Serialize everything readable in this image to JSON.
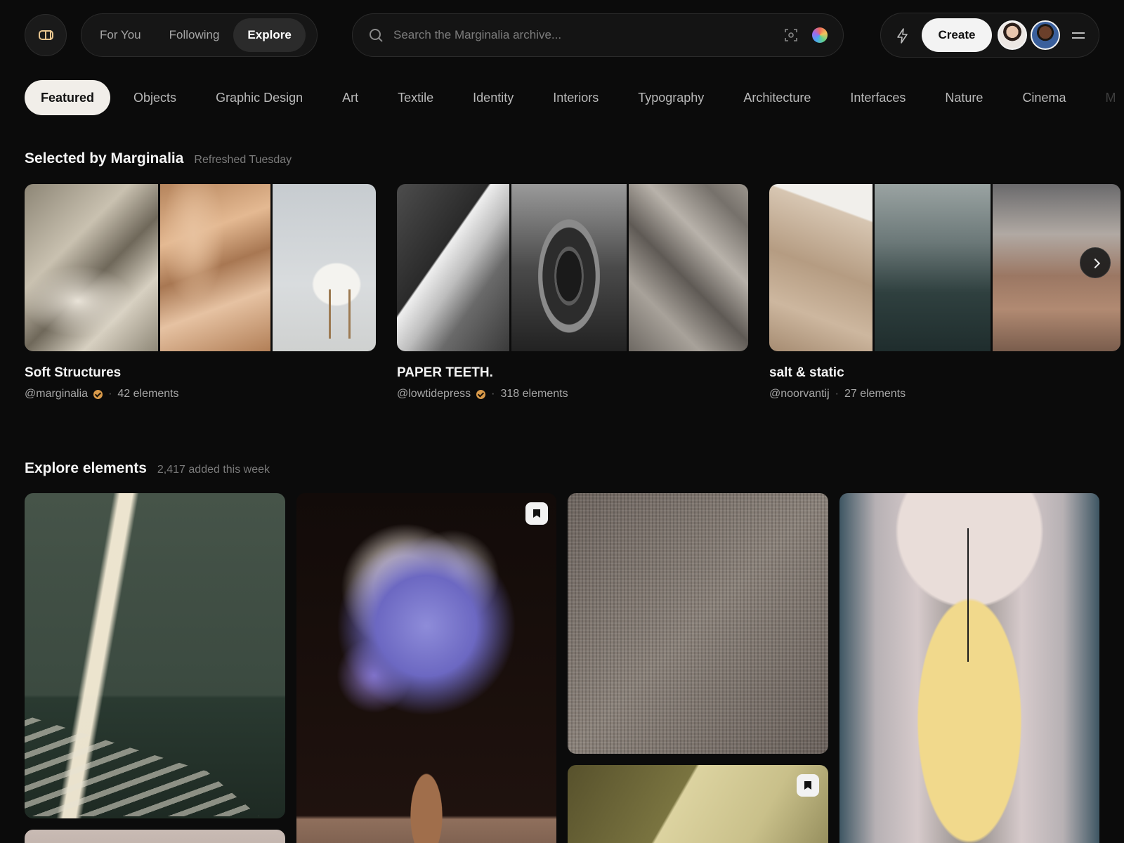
{
  "header": {
    "feed_tabs": [
      {
        "label": "For You",
        "active": false
      },
      {
        "label": "Following",
        "active": false
      },
      {
        "label": "Explore",
        "active": true
      }
    ],
    "search": {
      "placeholder": "Search the Marginalia archive..."
    },
    "create_label": "Create",
    "icons": [
      "logo-icon",
      "search-icon",
      "visual-search-icon",
      "color-search-icon",
      "bolt-icon",
      "menu-icon"
    ]
  },
  "categories": [
    {
      "label": "Featured",
      "active": true
    },
    {
      "label": "Objects"
    },
    {
      "label": "Graphic Design"
    },
    {
      "label": "Art"
    },
    {
      "label": "Textile"
    },
    {
      "label": "Identity"
    },
    {
      "label": "Interiors"
    },
    {
      "label": "Typography"
    },
    {
      "label": "Architecture"
    },
    {
      "label": "Interfaces"
    },
    {
      "label": "Nature"
    },
    {
      "label": "Cinema"
    },
    {
      "label": "M"
    }
  ],
  "selected": {
    "title": "Selected by Marginalia",
    "subtitle": "Refreshed Tuesday",
    "collections": [
      {
        "name": "Soft Structures",
        "owner": "@marginalia",
        "verified": true,
        "count": "42 elements"
      },
      {
        "name": "PAPER TEETH.",
        "owner": "@lowtidepress",
        "verified": true,
        "count": "318 elements"
      },
      {
        "name": "salt & static",
        "owner": "@noorvantij",
        "verified": false,
        "count": "27 elements"
      }
    ]
  },
  "explore": {
    "title": "Explore elements",
    "subtitle": "2,417 added this week"
  },
  "colors": {
    "background": "#0b0b0b",
    "accent_verified": "#d99a4a",
    "logo": "#e7c58f"
  }
}
